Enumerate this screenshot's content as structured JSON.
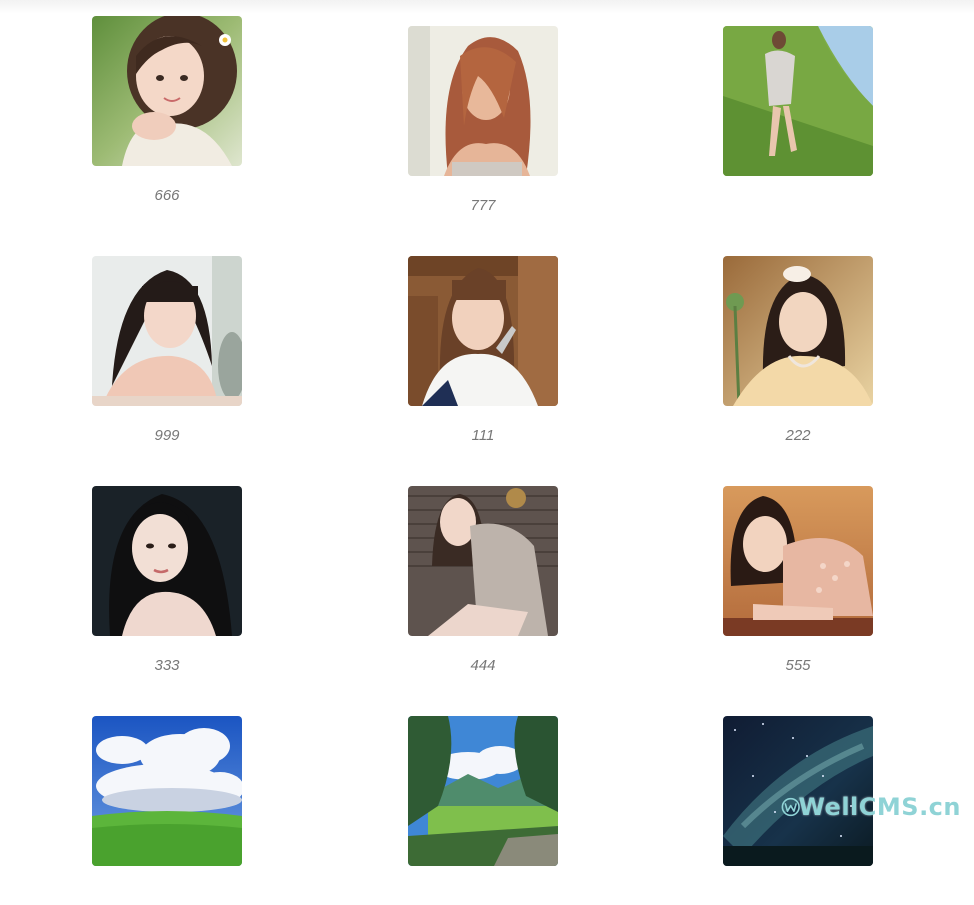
{
  "gallery": {
    "items": [
      {
        "caption": "666",
        "subject": "girl-with-flower-portrait"
      },
      {
        "caption": "777",
        "subject": "red-hair-portrait"
      },
      {
        "caption": "",
        "subject": "girl-in-grass-field"
      },
      {
        "caption": "999",
        "subject": "girl-with-bangs-portrait"
      },
      {
        "caption": "111",
        "subject": "girl-in-sailor-uniform"
      },
      {
        "caption": "222",
        "subject": "girl-with-flower-warm-light"
      },
      {
        "caption": "333",
        "subject": "dark-hair-portrait"
      },
      {
        "caption": "444",
        "subject": "girl-in-grey-dress"
      },
      {
        "caption": "555",
        "subject": "girl-in-sequin-dress"
      },
      {
        "caption": "",
        "subject": "clouds-and-green-field"
      },
      {
        "caption": "",
        "subject": "anime-landscape"
      },
      {
        "caption": "",
        "subject": "milky-way-night-sky"
      }
    ]
  },
  "watermark": {
    "text": "WellCMS.cn",
    "color": "#8fd3d6"
  }
}
